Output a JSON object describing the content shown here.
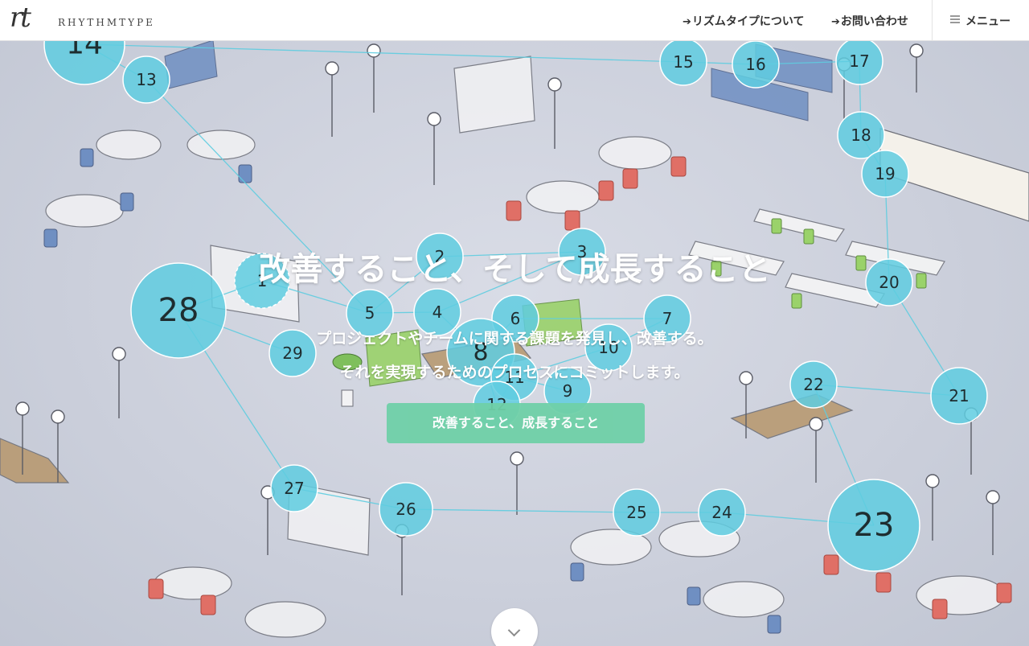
{
  "header": {
    "logo_mark": "rt",
    "logo_text": "RHYTHMTYPE",
    "nav": [
      {
        "label": "リズムタイプについて",
        "icon": "arrow-right-icon"
      },
      {
        "label": "お問い合わせ",
        "icon": "arrow-right-icon"
      }
    ],
    "menu": {
      "label": "メニュー",
      "icon": "hamburger-icon"
    }
  },
  "hero": {
    "title": "改善すること、そして成長すること",
    "line1": "プロジェクトやチームに関する課題を発見し、改善する。",
    "line2": "それを実現するためのプロセスにコミットします。",
    "cta_label": "改善すること、成長すること",
    "scroll_icon": "chevron-down-icon"
  },
  "network": {
    "color": "#5fcde0",
    "nodes": [
      "1",
      "2",
      "3",
      "4",
      "5",
      "6",
      "7",
      "8",
      "9",
      "10",
      "11",
      "12",
      "13",
      "14",
      "15",
      "16",
      "17",
      "18",
      "19",
      "20",
      "21",
      "22",
      "23",
      "24",
      "25",
      "26",
      "27",
      "28",
      "29"
    ]
  }
}
